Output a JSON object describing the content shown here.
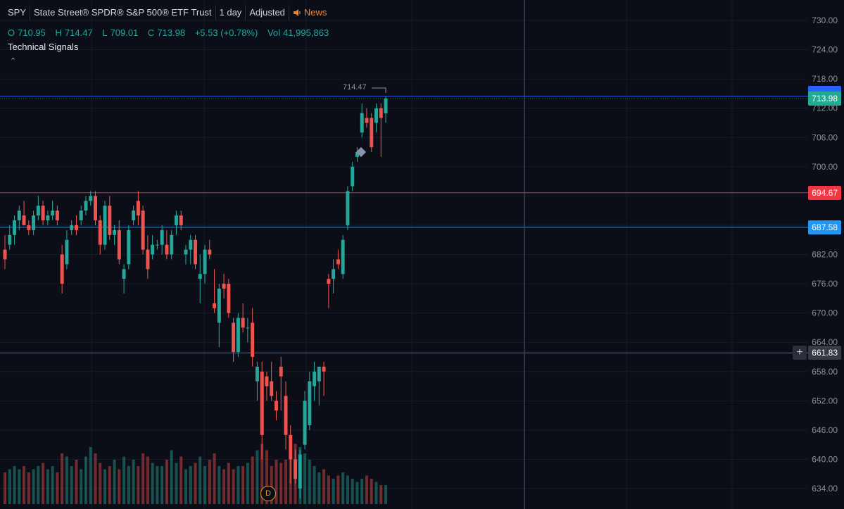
{
  "header": {
    "symbol": "SPY",
    "name": "State Street® SPDR® S&P 500® ETF Trust",
    "interval": "1 day",
    "adjust": "Adjusted",
    "news": "News"
  },
  "ohlc": {
    "o_label": "O",
    "o": "710.95",
    "h_label": "H",
    "h": "714.47",
    "l_label": "L",
    "l": "709.01",
    "c_label": "C",
    "c": "713.98",
    "change": "+5.53 (+0.78%)",
    "vol_label": "Vol",
    "vol": "41,995,863"
  },
  "indicator_label": "Technical Signals",
  "collapse_icon": "chevron-up-icon",
  "high_marker": "714.47",
  "price_badges": [
    {
      "label": "713.98",
      "color": "#22ab94",
      "frame": "#2962ff"
    },
    {
      "label": "694.67",
      "color": "#f23645"
    },
    {
      "label": "687.58",
      "color": "#2196f3"
    },
    {
      "label": "661.83",
      "color": "#363a45"
    }
  ],
  "dividend_marker": "D",
  "colors": {
    "up": "#26a69a",
    "down": "#ef5350",
    "bg": "#0b0e17"
  },
  "chart_data": {
    "type": "candlestick",
    "y_axis_ticks": [
      "730.00",
      "724.00",
      "718.00",
      "712.00",
      "706.00",
      "700.00",
      "694.00",
      "688.00",
      "682.00",
      "676.00",
      "670.00",
      "664.00",
      "658.00",
      "652.00",
      "646.00",
      "640.00",
      "634.00"
    ],
    "ylim": [
      632,
      732
    ],
    "horizontal_lines": [
      {
        "value": 714.47,
        "color": "#2962ff"
      },
      {
        "value": 694.67,
        "color": "#f23645"
      },
      {
        "value": 687.58,
        "color": "#2196f3"
      },
      {
        "value": 661.83,
        "color": "#5b6bbb"
      }
    ],
    "candles": [
      {
        "o": 683,
        "h": 686,
        "l": 679,
        "c": 681
      },
      {
        "o": 684,
        "h": 688,
        "l": 683,
        "c": 686
      },
      {
        "o": 686,
        "h": 690,
        "l": 684,
        "c": 689
      },
      {
        "o": 689,
        "h": 692,
        "l": 687,
        "c": 691
      },
      {
        "o": 690,
        "h": 693,
        "l": 688,
        "c": 688
      },
      {
        "o": 688,
        "h": 689,
        "l": 686,
        "c": 687
      },
      {
        "o": 687,
        "h": 691,
        "l": 686,
        "c": 690
      },
      {
        "o": 690,
        "h": 694,
        "l": 689,
        "c": 692
      },
      {
        "o": 692,
        "h": 693,
        "l": 688,
        "c": 689
      },
      {
        "o": 689,
        "h": 691,
        "l": 688,
        "c": 690
      },
      {
        "o": 690,
        "h": 693,
        "l": 689,
        "c": 691
      },
      {
        "o": 691,
        "h": 692,
        "l": 688,
        "c": 689
      },
      {
        "o": 682,
        "h": 684,
        "l": 674,
        "c": 676
      },
      {
        "o": 680,
        "h": 687,
        "l": 679,
        "c": 685
      },
      {
        "o": 687,
        "h": 689,
        "l": 686,
        "c": 688
      },
      {
        "o": 688,
        "h": 690,
        "l": 686,
        "c": 687
      },
      {
        "o": 689,
        "h": 692,
        "l": 688,
        "c": 691
      },
      {
        "o": 691,
        "h": 694,
        "l": 690,
        "c": 693
      },
      {
        "o": 693,
        "h": 695,
        "l": 692,
        "c": 694
      },
      {
        "o": 694,
        "h": 695,
        "l": 688,
        "c": 689
      },
      {
        "o": 689,
        "h": 690,
        "l": 682,
        "c": 684
      },
      {
        "o": 684,
        "h": 693,
        "l": 683,
        "c": 692
      },
      {
        "o": 692,
        "h": 694,
        "l": 685,
        "c": 686
      },
      {
        "o": 686,
        "h": 688,
        "l": 684,
        "c": 687
      },
      {
        "o": 687,
        "h": 689,
        "l": 680,
        "c": 681
      },
      {
        "o": 677,
        "h": 680,
        "l": 674,
        "c": 679
      },
      {
        "o": 680,
        "h": 688,
        "l": 679,
        "c": 687
      },
      {
        "o": 689,
        "h": 692,
        "l": 688,
        "c": 691
      },
      {
        "o": 693,
        "h": 695,
        "l": 688,
        "c": 690
      },
      {
        "o": 691,
        "h": 692,
        "l": 682,
        "c": 683
      },
      {
        "o": 683,
        "h": 686,
        "l": 677,
        "c": 679
      },
      {
        "o": 682,
        "h": 686,
        "l": 681,
        "c": 684
      },
      {
        "o": 684,
        "h": 685,
        "l": 683,
        "c": 684
      },
      {
        "o": 684,
        "h": 688,
        "l": 682,
        "c": 687
      },
      {
        "o": 684,
        "h": 687,
        "l": 681,
        "c": 682
      },
      {
        "o": 682,
        "h": 687,
        "l": 681,
        "c": 686
      },
      {
        "o": 688,
        "h": 691,
        "l": 686,
        "c": 690
      },
      {
        "o": 690,
        "h": 691,
        "l": 687,
        "c": 688
      },
      {
        "o": 682,
        "h": 684,
        "l": 680,
        "c": 683
      },
      {
        "o": 683,
        "h": 686,
        "l": 680,
        "c": 685
      },
      {
        "o": 685,
        "h": 686,
        "l": 679,
        "c": 680
      },
      {
        "o": 677,
        "h": 682,
        "l": 672,
        "c": 678
      },
      {
        "o": 678,
        "h": 684,
        "l": 676,
        "c": 683
      },
      {
        "o": 683,
        "h": 685,
        "l": 681,
        "c": 682
      },
      {
        "o": 672,
        "h": 679,
        "l": 670,
        "c": 671
      },
      {
        "o": 668,
        "h": 676,
        "l": 663,
        "c": 675
      },
      {
        "o": 676,
        "h": 678,
        "l": 673,
        "c": 675
      },
      {
        "o": 676,
        "h": 677,
        "l": 669,
        "c": 670
      },
      {
        "o": 668,
        "h": 669,
        "l": 660,
        "c": 662
      },
      {
        "o": 662,
        "h": 670,
        "l": 661,
        "c": 669
      },
      {
        "o": 669,
        "h": 672,
        "l": 666,
        "c": 667
      },
      {
        "o": 667,
        "h": 669,
        "l": 664,
        "c": 667
      },
      {
        "o": 668,
        "h": 671,
        "l": 659,
        "c": 661
      },
      {
        "o": 656,
        "h": 660,
        "l": 652,
        "c": 659
      },
      {
        "o": 658,
        "h": 660,
        "l": 640,
        "c": 645
      },
      {
        "o": 657,
        "h": 658,
        "l": 652,
        "c": 655
      },
      {
        "o": 656,
        "h": 660,
        "l": 652,
        "c": 653
      },
      {
        "o": 652,
        "h": 654,
        "l": 648,
        "c": 650
      },
      {
        "o": 659,
        "h": 661,
        "l": 650,
        "c": 657
      },
      {
        "o": 653,
        "h": 656,
        "l": 642,
        "c": 645
      },
      {
        "o": 645,
        "h": 647,
        "l": 635,
        "c": 640
      },
      {
        "o": 640,
        "h": 642,
        "l": 635,
        "c": 636
      },
      {
        "o": 634,
        "h": 642,
        "l": 632,
        "c": 641
      },
      {
        "o": 643,
        "h": 654,
        "l": 642,
        "c": 652
      },
      {
        "o": 647,
        "h": 658,
        "l": 646,
        "c": 656
      },
      {
        "o": 655,
        "h": 660,
        "l": 652,
        "c": 658
      },
      {
        "o": 656,
        "h": 659,
        "l": 651,
        "c": 659
      },
      {
        "o": 659,
        "h": 660,
        "l": 653,
        "c": 658
      },
      {
        "o": 677,
        "h": 678,
        "l": 671,
        "c": 676
      },
      {
        "o": 677,
        "h": 681,
        "l": 674,
        "c": 679
      },
      {
        "o": 681,
        "h": 683,
        "l": 679,
        "c": 680
      },
      {
        "o": 678,
        "h": 686,
        "l": 677,
        "c": 685
      },
      {
        "o": 688,
        "h": 696,
        "l": 687,
        "c": 695
      },
      {
        "o": 696,
        "h": 701,
        "l": 695,
        "c": 700
      },
      {
        "o": 702,
        "h": 704,
        "l": 701,
        "c": 703
      },
      {
        "o": 707,
        "h": 713,
        "l": 706,
        "c": 711
      },
      {
        "o": 710,
        "h": 712,
        "l": 708,
        "c": 709
      },
      {
        "o": 710,
        "h": 711,
        "l": 703,
        "c": 704
      },
      {
        "o": 709,
        "h": 713,
        "l": 707,
        "c": 712
      },
      {
        "o": 712,
        "h": 713,
        "l": 702,
        "c": 710
      },
      {
        "o": 710.95,
        "h": 714.47,
        "l": 709.01,
        "c": 713.98
      }
    ],
    "volume_relative": [
      0.5,
      0.55,
      0.6,
      0.55,
      0.6,
      0.5,
      0.55,
      0.6,
      0.65,
      0.55,
      0.6,
      0.5,
      0.8,
      0.75,
      0.6,
      0.7,
      0.55,
      0.75,
      0.9,
      0.8,
      0.65,
      0.55,
      0.6,
      0.7,
      0.55,
      0.75,
      0.6,
      0.7,
      0.6,
      0.8,
      0.75,
      0.65,
      0.6,
      0.6,
      0.7,
      0.85,
      0.65,
      0.75,
      0.55,
      0.6,
      0.65,
      0.75,
      0.6,
      0.7,
      0.8,
      0.6,
      0.55,
      0.65,
      0.55,
      0.6,
      0.6,
      0.65,
      0.75,
      0.85,
      0.95,
      0.85,
      0.6,
      0.7,
      0.65,
      0.7,
      0.75,
      0.95,
      0.9,
      0.8,
      0.7,
      0.6,
      0.5,
      0.55,
      0.45,
      0.4,
      0.45,
      0.5,
      0.45,
      0.4,
      0.35,
      0.4,
      0.45,
      0.4,
      0.35,
      0.3,
      0.3
    ]
  }
}
